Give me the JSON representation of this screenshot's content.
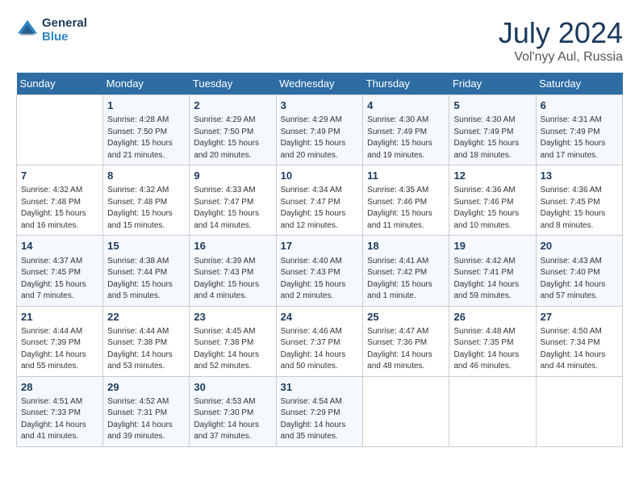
{
  "header": {
    "logo_line1": "General",
    "logo_line2": "Blue",
    "month_year": "July 2024",
    "location": "Vol'nyy Aul, Russia"
  },
  "days_of_week": [
    "Sunday",
    "Monday",
    "Tuesday",
    "Wednesday",
    "Thursday",
    "Friday",
    "Saturday"
  ],
  "weeks": [
    [
      {
        "day": "",
        "content": ""
      },
      {
        "day": "1",
        "content": "Sunrise: 4:28 AM\nSunset: 7:50 PM\nDaylight: 15 hours\nand 21 minutes."
      },
      {
        "day": "2",
        "content": "Sunrise: 4:29 AM\nSunset: 7:50 PM\nDaylight: 15 hours\nand 20 minutes."
      },
      {
        "day": "3",
        "content": "Sunrise: 4:29 AM\nSunset: 7:49 PM\nDaylight: 15 hours\nand 20 minutes."
      },
      {
        "day": "4",
        "content": "Sunrise: 4:30 AM\nSunset: 7:49 PM\nDaylight: 15 hours\nand 19 minutes."
      },
      {
        "day": "5",
        "content": "Sunrise: 4:30 AM\nSunset: 7:49 PM\nDaylight: 15 hours\nand 18 minutes."
      },
      {
        "day": "6",
        "content": "Sunrise: 4:31 AM\nSunset: 7:49 PM\nDaylight: 15 hours\nand 17 minutes."
      }
    ],
    [
      {
        "day": "7",
        "content": "Sunrise: 4:32 AM\nSunset: 7:48 PM\nDaylight: 15 hours\nand 16 minutes."
      },
      {
        "day": "8",
        "content": "Sunrise: 4:32 AM\nSunset: 7:48 PM\nDaylight: 15 hours\nand 15 minutes."
      },
      {
        "day": "9",
        "content": "Sunrise: 4:33 AM\nSunset: 7:47 PM\nDaylight: 15 hours\nand 14 minutes."
      },
      {
        "day": "10",
        "content": "Sunrise: 4:34 AM\nSunset: 7:47 PM\nDaylight: 15 hours\nand 12 minutes."
      },
      {
        "day": "11",
        "content": "Sunrise: 4:35 AM\nSunset: 7:46 PM\nDaylight: 15 hours\nand 11 minutes."
      },
      {
        "day": "12",
        "content": "Sunrise: 4:36 AM\nSunset: 7:46 PM\nDaylight: 15 hours\nand 10 minutes."
      },
      {
        "day": "13",
        "content": "Sunrise: 4:36 AM\nSunset: 7:45 PM\nDaylight: 15 hours\nand 8 minutes."
      }
    ],
    [
      {
        "day": "14",
        "content": "Sunrise: 4:37 AM\nSunset: 7:45 PM\nDaylight: 15 hours\nand 7 minutes."
      },
      {
        "day": "15",
        "content": "Sunrise: 4:38 AM\nSunset: 7:44 PM\nDaylight: 15 hours\nand 5 minutes."
      },
      {
        "day": "16",
        "content": "Sunrise: 4:39 AM\nSunset: 7:43 PM\nDaylight: 15 hours\nand 4 minutes."
      },
      {
        "day": "17",
        "content": "Sunrise: 4:40 AM\nSunset: 7:43 PM\nDaylight: 15 hours\nand 2 minutes."
      },
      {
        "day": "18",
        "content": "Sunrise: 4:41 AM\nSunset: 7:42 PM\nDaylight: 15 hours\nand 1 minute."
      },
      {
        "day": "19",
        "content": "Sunrise: 4:42 AM\nSunset: 7:41 PM\nDaylight: 14 hours\nand 59 minutes."
      },
      {
        "day": "20",
        "content": "Sunrise: 4:43 AM\nSunset: 7:40 PM\nDaylight: 14 hours\nand 57 minutes."
      }
    ],
    [
      {
        "day": "21",
        "content": "Sunrise: 4:44 AM\nSunset: 7:39 PM\nDaylight: 14 hours\nand 55 minutes."
      },
      {
        "day": "22",
        "content": "Sunrise: 4:44 AM\nSunset: 7:38 PM\nDaylight: 14 hours\nand 53 minutes."
      },
      {
        "day": "23",
        "content": "Sunrise: 4:45 AM\nSunset: 7:38 PM\nDaylight: 14 hours\nand 52 minutes."
      },
      {
        "day": "24",
        "content": "Sunrise: 4:46 AM\nSunset: 7:37 PM\nDaylight: 14 hours\nand 50 minutes."
      },
      {
        "day": "25",
        "content": "Sunrise: 4:47 AM\nSunset: 7:36 PM\nDaylight: 14 hours\nand 48 minutes."
      },
      {
        "day": "26",
        "content": "Sunrise: 4:48 AM\nSunset: 7:35 PM\nDaylight: 14 hours\nand 46 minutes."
      },
      {
        "day": "27",
        "content": "Sunrise: 4:50 AM\nSunset: 7:34 PM\nDaylight: 14 hours\nand 44 minutes."
      }
    ],
    [
      {
        "day": "28",
        "content": "Sunrise: 4:51 AM\nSunset: 7:33 PM\nDaylight: 14 hours\nand 41 minutes."
      },
      {
        "day": "29",
        "content": "Sunrise: 4:52 AM\nSunset: 7:31 PM\nDaylight: 14 hours\nand 39 minutes."
      },
      {
        "day": "30",
        "content": "Sunrise: 4:53 AM\nSunset: 7:30 PM\nDaylight: 14 hours\nand 37 minutes."
      },
      {
        "day": "31",
        "content": "Sunrise: 4:54 AM\nSunset: 7:29 PM\nDaylight: 14 hours\nand 35 minutes."
      },
      {
        "day": "",
        "content": ""
      },
      {
        "day": "",
        "content": ""
      },
      {
        "day": "",
        "content": ""
      }
    ]
  ]
}
